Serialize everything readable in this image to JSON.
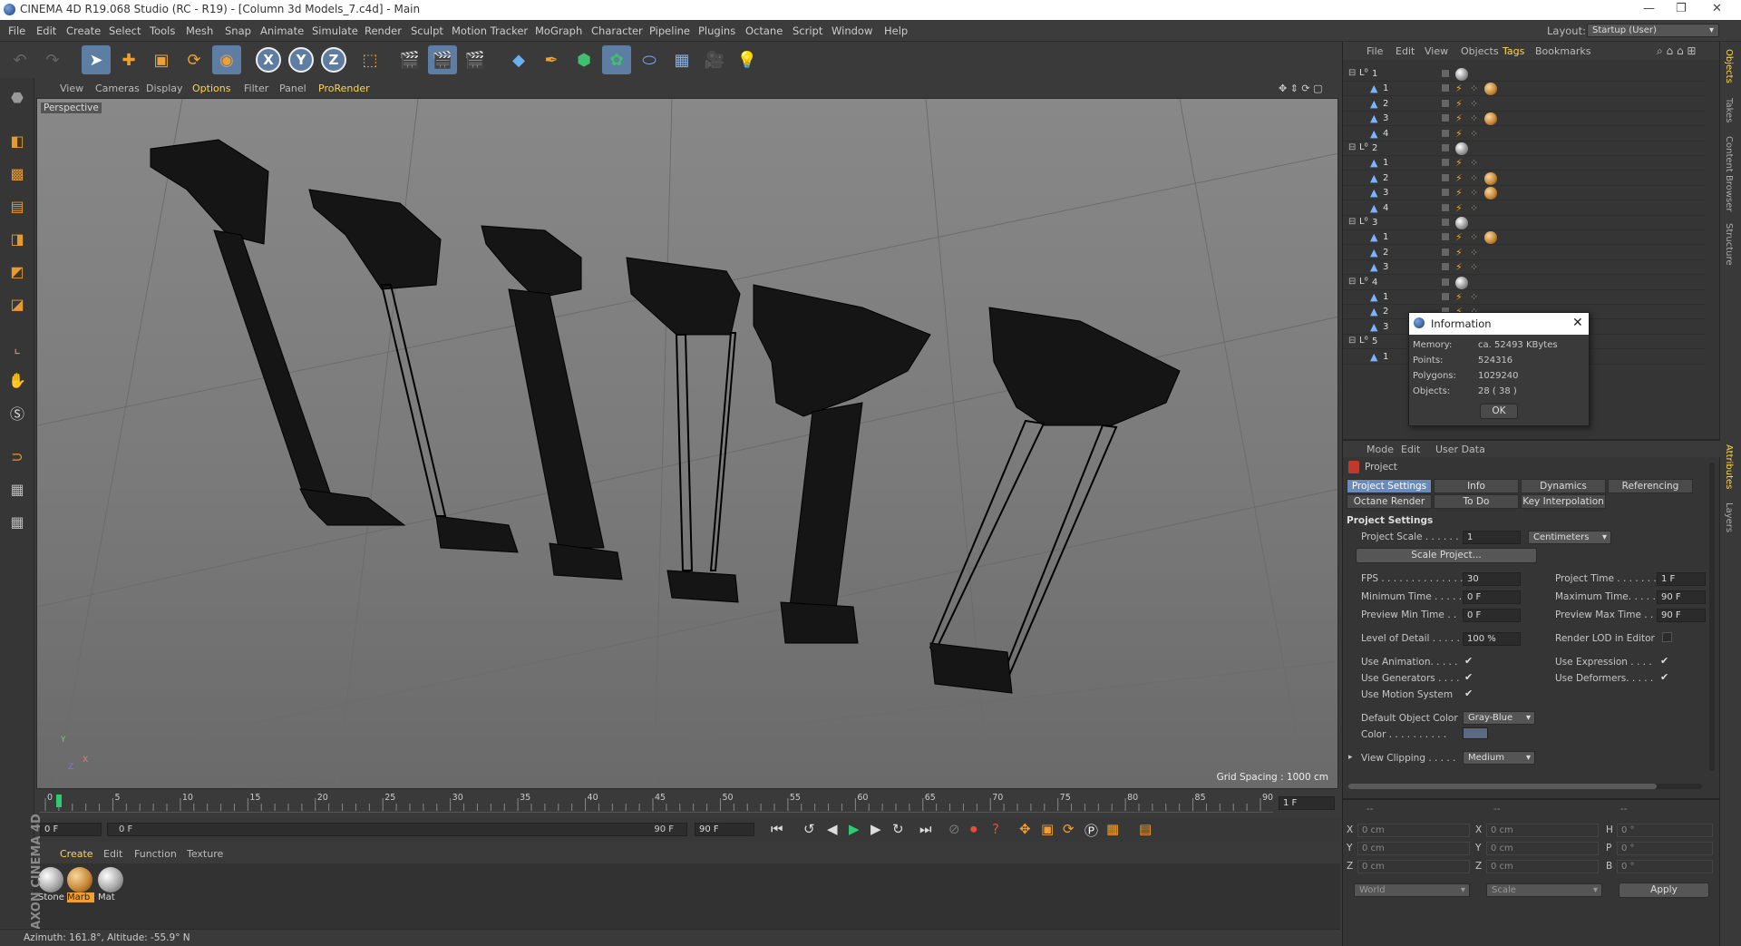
{
  "window": {
    "title": "CINEMA 4D R19.068 Studio (RC - R19) - [Column 3d Models_7.c4d] - Main",
    "controls": [
      "—",
      "❐",
      "✕"
    ]
  },
  "menu": {
    "items": [
      "File",
      "Edit",
      "Create",
      "Select",
      "Tools",
      "Mesh",
      "Snap",
      "Animate",
      "Simulate",
      "Render",
      "Sculpt",
      "Motion Tracker",
      "MoGraph",
      "Character",
      "Pipeline",
      "Plugins",
      "Octane",
      "Script",
      "Window",
      "Help"
    ],
    "layout_label": "Layout:",
    "layout_value": "Startup (User)"
  },
  "toolbar": {
    "icons": [
      "undo-icon",
      "redo-icon",
      "select-arrow-icon",
      "move-icon",
      "scale-icon",
      "rotate-icon",
      "live-select-icon",
      "x-axis-icon",
      "y-axis-icon",
      "z-axis-icon",
      "coordinate-system-icon",
      "render-view-icon",
      "render-picture-viewer-icon",
      "render-settings-icon",
      "cube-icon",
      "pen-icon",
      "subdivision-icon",
      "cloner-icon",
      "deformer-icon",
      "floor-icon",
      "camera-icon",
      "light-icon"
    ],
    "axis_labels": [
      "X",
      "Y",
      "Z"
    ]
  },
  "viewport": {
    "menu": [
      "View",
      "Cameras",
      "Display",
      "Options",
      "Filter",
      "Panel",
      "ProRender"
    ],
    "highlighted_menu": "Options",
    "label": "Perspective",
    "grid_spacing": "Grid Spacing : 1000 cm",
    "axis_labels": [
      "Y",
      "X",
      "Z"
    ]
  },
  "timeline": {
    "ticks": [
      "0",
      "5",
      "10",
      "15",
      "20",
      "25",
      "30",
      "35",
      "40",
      "45",
      "50",
      "55",
      "60",
      "65",
      "70",
      "75",
      "80",
      "85",
      "90"
    ],
    "frame_display": "1 F",
    "current_frame": 1,
    "total_frames": 90
  },
  "playbar": {
    "start_field": "0 F",
    "range_start": "0 F",
    "range_end": "90 F",
    "end_field": "90 F"
  },
  "materials": {
    "menu": [
      "Create",
      "Edit",
      "Function",
      "Texture"
    ],
    "items": [
      {
        "label": "Stone",
        "selected": false
      },
      {
        "label": "Marb",
        "selected": true
      },
      {
        "label": "Mat",
        "selected": false
      }
    ],
    "brand": "MAXON CINEMA 4D"
  },
  "status": {
    "text": "Azimuth: 161.8°, Altitude: -55.9°  N"
  },
  "object_manager": {
    "menu": [
      "File",
      "Edit",
      "View",
      "Objects",
      "Tags",
      "Bookmarks"
    ],
    "highlighted_menu": "Tags",
    "groups": [
      {
        "name": "1",
        "children": [
          {
            "name": "1",
            "tex": true
          },
          {
            "name": "2",
            "tex": false
          },
          {
            "name": "3",
            "tex": true
          },
          {
            "name": "4",
            "tex": false
          }
        ]
      },
      {
        "name": "2",
        "children": [
          {
            "name": "1",
            "tex": false
          },
          {
            "name": "2",
            "tex": true
          },
          {
            "name": "3",
            "tex": true
          },
          {
            "name": "4",
            "tex": false
          }
        ]
      },
      {
        "name": "3",
        "children": [
          {
            "name": "1",
            "tex": true
          },
          {
            "name": "2",
            "tex": false
          },
          {
            "name": "3",
            "tex": false
          }
        ]
      },
      {
        "name": "4",
        "children": [
          {
            "name": "1",
            "tex": false
          },
          {
            "name": "2",
            "tex": false
          },
          {
            "name": "3",
            "tex": false
          }
        ]
      },
      {
        "name": "5",
        "children": [
          {
            "name": "1",
            "tex": false
          }
        ]
      }
    ]
  },
  "info_dialog": {
    "title": "Information",
    "rows": [
      {
        "label": "Memory:",
        "value": "ca. 52493 KBytes"
      },
      {
        "label": "Points:",
        "value": "524316"
      },
      {
        "label": "Polygons:",
        "value": "1029240"
      },
      {
        "label": "Objects:",
        "value": "28 ( 38 )"
      }
    ],
    "ok_label": "OK"
  },
  "right_strip": [
    "Objects",
    "Takes",
    "Content Browser",
    "Structure",
    "Attributes",
    "Layers"
  ],
  "attributes": {
    "menu": [
      "Mode",
      "Edit",
      "User Data"
    ],
    "object_label": "Project",
    "tabs_row1": [
      "Project Settings",
      "Info",
      "Dynamics",
      "Referencing"
    ],
    "tabs_row2": [
      "Octane Render",
      "To Do",
      "Key Interpolation"
    ],
    "section": "Project Settings",
    "project_scale_label": "Project Scale . . . . . .",
    "project_scale_value": "1",
    "project_scale_unit": "Centimeters",
    "scale_button": "Scale Project...",
    "fields_left": [
      {
        "label": "FPS . . . . . . . . . . . . . .",
        "value": "30"
      },
      {
        "label": "Minimum Time . . . . .",
        "value": "0 F"
      },
      {
        "label": "Preview Min Time . .",
        "value": "0 F"
      }
    ],
    "fields_right": [
      {
        "label": "Project Time . . . . . . .",
        "value": "1 F"
      },
      {
        "label": "Maximum Time. . . . .",
        "value": "90 F"
      },
      {
        "label": "Preview Max Time . .",
        "value": "90 F"
      }
    ],
    "lod_label": "Level of Detail . . . . .",
    "lod_value": "100 %",
    "render_lod_label": "Render LOD in Editor",
    "checks_left": [
      "Use Animation. . . . .",
      "Use Generators . . . .",
      "Use Motion System"
    ],
    "checks_right": [
      "Use Expression . . . .",
      "Use Deformers. . . . ."
    ],
    "default_color_label": "Default Object Color",
    "default_color_value": "Gray-Blue",
    "color_label": "Color . . . . . . . . . .",
    "color_swatch": "#5a6a82",
    "view_clipping_label": "View Clipping . . . . .",
    "view_clipping_value": "Medium"
  },
  "coordinates": {
    "header": [
      "--",
      "--",
      "--"
    ],
    "rows": [
      {
        "a": "X",
        "av": "0 cm",
        "b": "X",
        "bv": "0 cm",
        "c": "H",
        "cv": "0 °"
      },
      {
        "a": "Y",
        "av": "0 cm",
        "b": "Y",
        "bv": "0 cm",
        "c": "P",
        "cv": "0 °"
      },
      {
        "a": "Z",
        "av": "0 cm",
        "b": "Z",
        "bv": "0 cm",
        "c": "B",
        "cv": "0 °"
      }
    ],
    "space": "World",
    "mode": "Scale",
    "apply": "Apply"
  }
}
